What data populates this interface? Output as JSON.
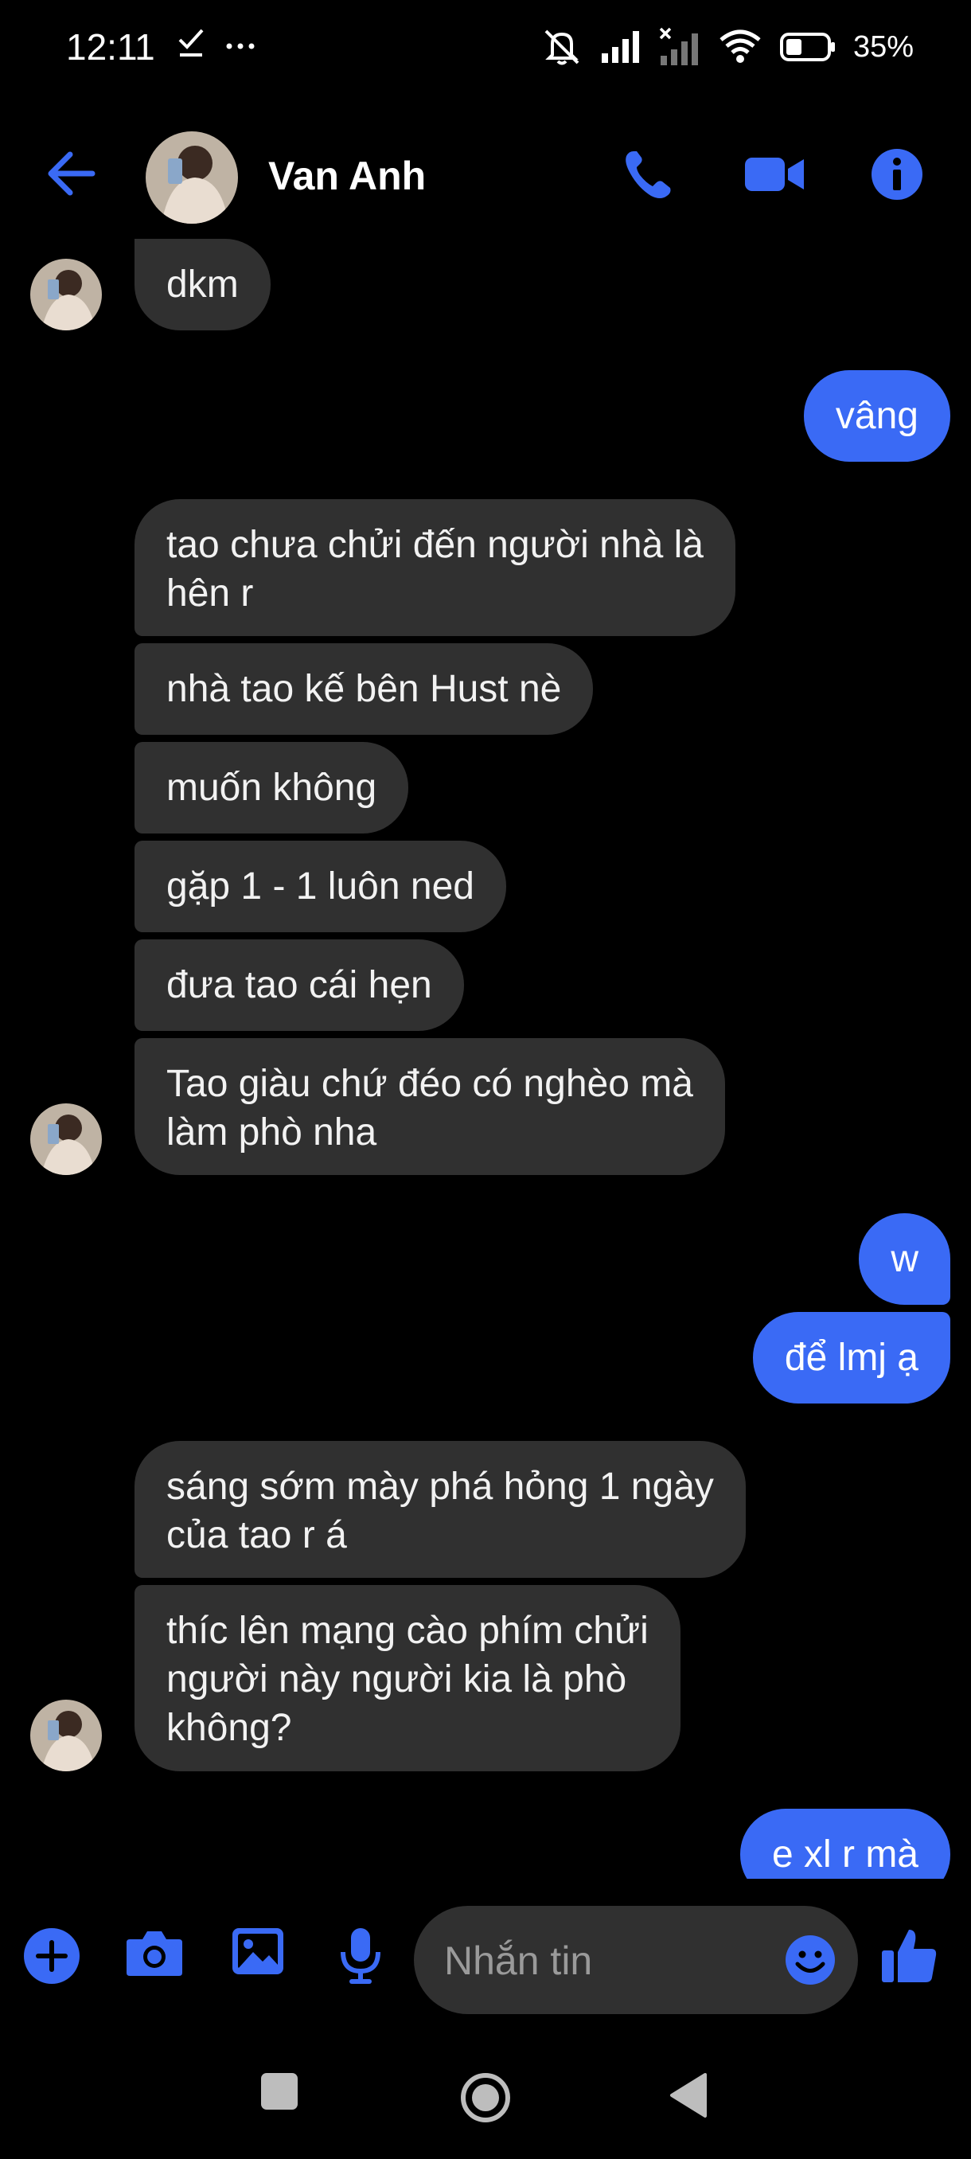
{
  "status_bar": {
    "time": "12:11",
    "battery": "35%",
    "left_icons": [
      "check-icon",
      "more-dots-icon"
    ],
    "right_icons": [
      "mute-icon",
      "signal-icon",
      "no-signal-icon",
      "wifi-icon",
      "battery-icon"
    ]
  },
  "header": {
    "contact_name": "Van Anh",
    "buttons": [
      "back-icon",
      "phone-icon",
      "video-icon",
      "info-icon"
    ]
  },
  "messages": [
    {
      "from": "them",
      "text": "dkm"
    },
    {
      "from": "me",
      "text": "vâng"
    },
    {
      "from": "them",
      "text": "tao chưa chửi đến người nhà là\nhên r"
    },
    {
      "from": "them",
      "text": "nhà tao kế bên Hust nè"
    },
    {
      "from": "them",
      "text": "muốn không"
    },
    {
      "from": "them",
      "text": "gặp 1 - 1 luôn ned"
    },
    {
      "from": "them",
      "text": "đưa tao cái hẹn"
    },
    {
      "from": "them",
      "text": "Tao giàu chứ đéo có nghèo mà\nlàm phò nha"
    },
    {
      "from": "me",
      "text": "w"
    },
    {
      "from": "me",
      "text": "để lmj ạ"
    },
    {
      "from": "them",
      "text": "sáng sớm mày phá hỏng 1 ngày\ncủa tao r á"
    },
    {
      "from": "them",
      "text": "thíc lên mạng cào phím chửi\nngười này người kia là phò\nkhông?"
    },
    {
      "from": "me",
      "text": "e xl r mà"
    }
  ],
  "composer": {
    "placeholder": "Nhắn tin",
    "buttons": [
      "plus-icon",
      "camera-icon",
      "gallery-icon",
      "mic-icon",
      "emoji-icon",
      "like-icon"
    ]
  },
  "colors": {
    "accent": "#3a6af5",
    "incoming_bubble": "#303030",
    "background": "#000000"
  }
}
